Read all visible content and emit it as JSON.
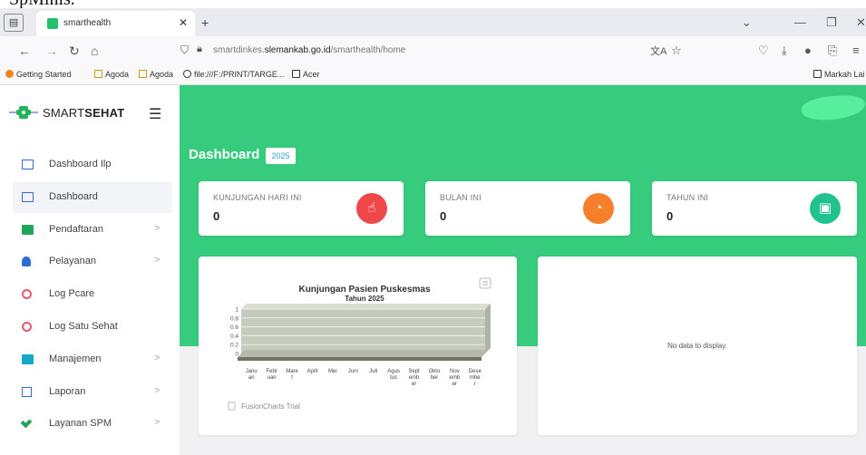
{
  "top_clip_text": "SpMinis.",
  "browser": {
    "tab_title": "smarthealth",
    "url_prefix": "smartdinkes.",
    "url_domain": "slemankab.go.id",
    "url_path": "/smarthealth/home",
    "bookmarks": [
      "Getting Started",
      "Agoda",
      "Agoda",
      "file:///F:/PRINT/TARGE...",
      "Acer"
    ],
    "bookmarks_right": "Markah Lai"
  },
  "app": {
    "brand_light": "SMART",
    "brand_bold": "SEHAT"
  },
  "sidebar": {
    "items": [
      {
        "label": "Dashboard Ilp",
        "icon": "monitor-icon",
        "chevron": false,
        "active": false
      },
      {
        "label": "Dashboard",
        "icon": "monitor-icon",
        "chevron": false,
        "active": true
      },
      {
        "label": "Pendaftaran",
        "icon": "folder-icon",
        "chevron": true,
        "active": false
      },
      {
        "label": "Pelayanan",
        "icon": "user-icon",
        "chevron": true,
        "active": false
      },
      {
        "label": "Log Pcare",
        "icon": "log-icon",
        "chevron": false,
        "active": false
      },
      {
        "label": "Log Satu Sehat",
        "icon": "log-icon",
        "chevron": false,
        "active": false
      },
      {
        "label": "Manajemen",
        "icon": "document-icon",
        "chevron": true,
        "active": false
      },
      {
        "label": "Laporan",
        "icon": "report-icon",
        "chevron": true,
        "active": false
      },
      {
        "label": "Layanan SPM",
        "icon": "tools-icon",
        "chevron": true,
        "active": false
      }
    ],
    "chevron_glyph": ">"
  },
  "dashboard": {
    "title": "Dashboard",
    "year": "2025",
    "stats": [
      {
        "label": "KUNJUNGAN HARI INI",
        "value": "0",
        "color": "#f0484a",
        "icon": "hand-pointer-icon"
      },
      {
        "label": "BULAN INI",
        "value": "0",
        "color": "#f57f2a",
        "icon": "pie-chart-icon"
      },
      {
        "label": "TAHUN INI",
        "value": "0",
        "color": "#22c28f",
        "icon": "calendar-icon"
      }
    ],
    "empty_message": "No data to display.",
    "fusion_text": "FusionCharts Trial"
  },
  "chart_data": {
    "type": "bar",
    "title": "Kunjungan Pasien Puskesmas",
    "subtitle": "Tahun 2025",
    "categories": [
      "Janu ari",
      "Febr uari",
      "Mare t",
      "April",
      "Mei",
      "Juni",
      "Juli",
      "Agus tus",
      "Sept emb er",
      "Okto ber",
      "Nov emb er",
      "Dese mbe r"
    ],
    "values": [
      0,
      0,
      0,
      0,
      0,
      0,
      0,
      0,
      0,
      0,
      0,
      0
    ],
    "yticks": [
      "1",
      "0.8",
      "0.6",
      "0.4",
      "0.2",
      "0"
    ],
    "ylim": [
      0,
      1
    ],
    "grid": true,
    "xlabel": "",
    "ylabel": ""
  }
}
